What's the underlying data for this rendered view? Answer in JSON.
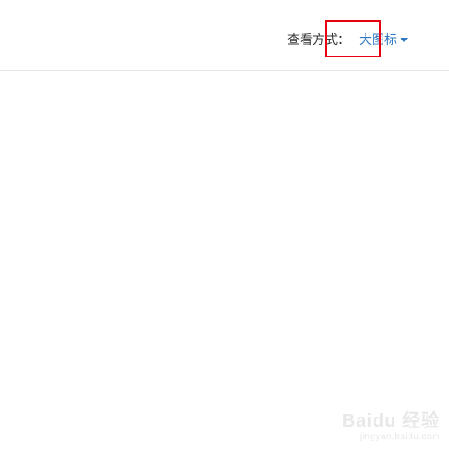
{
  "toolbar": {
    "view_mode_label": "查看方式：",
    "view_mode_value": "大图标"
  },
  "watermark": {
    "brand": "Baidu 经验",
    "url": "jingyan.baidu.com"
  }
}
